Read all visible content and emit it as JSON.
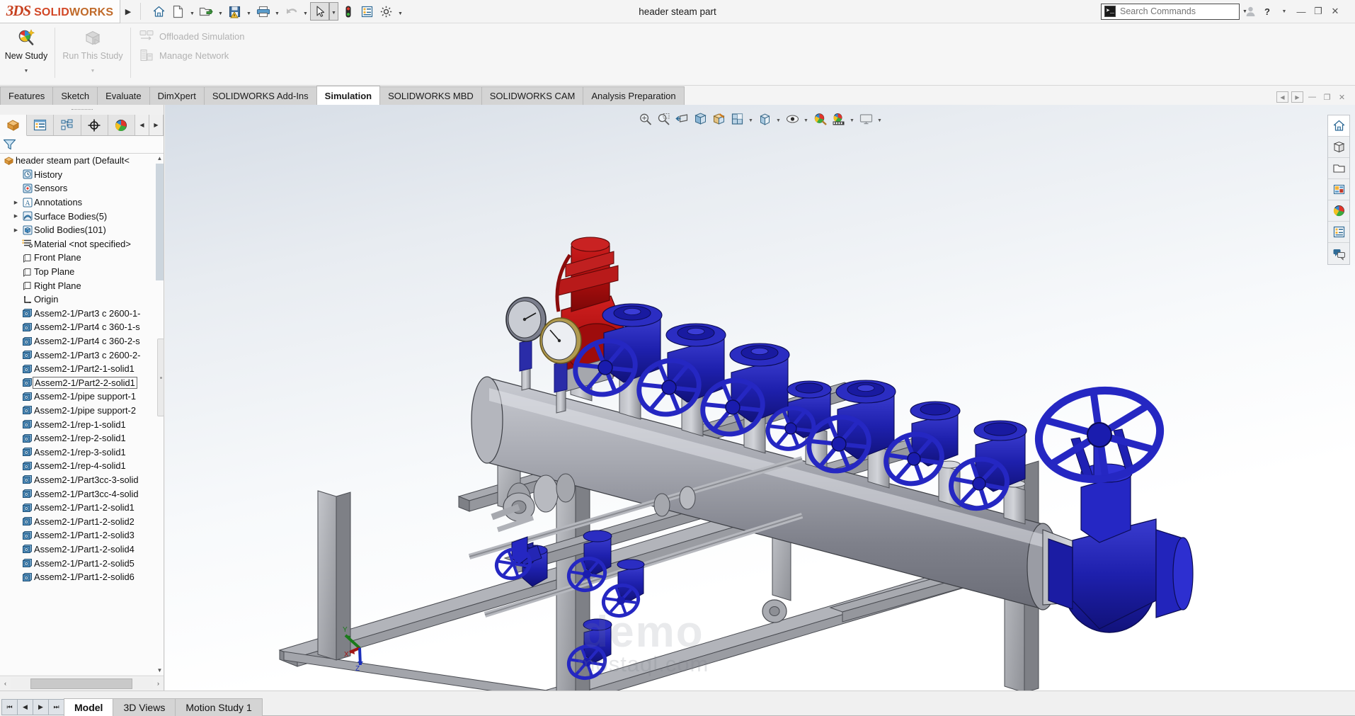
{
  "app": {
    "brand_ds": "3DS",
    "brand_solid": "SOLID",
    "brand_works": "WORKS",
    "document_title": "header steam part"
  },
  "titlebar": {
    "expand_label": "▶",
    "icons": [
      {
        "name": "home-icon",
        "label": "Home"
      },
      {
        "name": "new-document-icon",
        "label": "New"
      },
      {
        "name": "open-folder-icon",
        "label": "Open"
      },
      {
        "name": "save-warning-icon",
        "label": "Save"
      },
      {
        "name": "print-icon",
        "label": "Print"
      },
      {
        "name": "undo-icon",
        "label": "Undo"
      },
      {
        "name": "select-arrow-icon",
        "label": "Select"
      },
      {
        "name": "rebuild-icon",
        "label": "Rebuild"
      },
      {
        "name": "file-properties-icon",
        "label": "File Properties"
      },
      {
        "name": "options-gear-icon",
        "label": "Options"
      }
    ],
    "search": {
      "placeholder": "Search Commands",
      "value": "",
      "prompt_glyph": "➤_",
      "magnifier": "search-icon"
    },
    "account_icon": "user-account-icon",
    "help_label": "?",
    "minimize_label": "—",
    "restore_label": "❐",
    "close_label": "✕"
  },
  "ribbon": {
    "groups": [
      {
        "big_buttons": [
          {
            "name": "new-study-button",
            "label": "New Study",
            "icon": "new-study-icon",
            "disabled": false,
            "dropdown": true
          },
          {
            "name": "run-this-study-button",
            "label": "Run This Study",
            "icon": "run-study-icon",
            "disabled": true,
            "dropdown": true
          }
        ],
        "small_buttons": [
          {
            "name": "offloaded-simulation-button",
            "label": "Offloaded Simulation",
            "icon": "offloaded-simulation-icon",
            "disabled": true
          },
          {
            "name": "manage-network-button",
            "label": "Manage Network",
            "icon": "manage-network-icon",
            "disabled": true
          }
        ]
      }
    ]
  },
  "tabs": {
    "items": [
      {
        "name": "tab-features",
        "label": "Features",
        "active": false
      },
      {
        "name": "tab-sketch",
        "label": "Sketch",
        "active": false
      },
      {
        "name": "tab-evaluate",
        "label": "Evaluate",
        "active": false
      },
      {
        "name": "tab-dimxpert",
        "label": "DimXpert",
        "active": false
      },
      {
        "name": "tab-solidworks-addins",
        "label": "SOLIDWORKS Add-Ins",
        "active": false
      },
      {
        "name": "tab-simulation",
        "label": "Simulation",
        "active": true
      },
      {
        "name": "tab-solidworks-mbd",
        "label": "SOLIDWORKS MBD",
        "active": false
      },
      {
        "name": "tab-solidworks-cam",
        "label": "SOLIDWORKS CAM",
        "active": false
      },
      {
        "name": "tab-analysis-preparation",
        "label": "Analysis Preparation",
        "active": false
      }
    ],
    "right_controls": [
      {
        "name": "pin-left-button",
        "label": "◀"
      },
      {
        "name": "pin-right-button",
        "label": "▶"
      },
      {
        "name": "ribbon-minimize-button",
        "label": "—"
      },
      {
        "name": "ribbon-restore-button",
        "label": "❐"
      },
      {
        "name": "ribbon-close-button",
        "label": "✕"
      }
    ]
  },
  "left_panel": {
    "tabs": [
      {
        "name": "feature-manager-tab",
        "icon": "feature-tree-icon",
        "active": true
      },
      {
        "name": "property-manager-tab",
        "icon": "property-list-icon",
        "active": false
      },
      {
        "name": "configuration-manager-tab",
        "icon": "configuration-icon",
        "active": false
      },
      {
        "name": "dimxpert-manager-tab",
        "icon": "dimxpert-target-icon",
        "active": false
      },
      {
        "name": "display-manager-tab",
        "icon": "display-sphere-icon",
        "active": false
      },
      {
        "name": "tab-scroll-left",
        "icon": "chevron-left-icon",
        "label": "◀",
        "active": false
      },
      {
        "name": "tab-scroll-right",
        "icon": "chevron-right-icon",
        "label": "▶",
        "active": false
      }
    ],
    "filter": {
      "name": "tree-filter-input",
      "placeholder": "",
      "value": "",
      "icon": "funnel-filter-icon"
    },
    "tree": [
      {
        "label": "header steam part  (Default<",
        "icon": "part-icon",
        "indent": 0,
        "expandable": false,
        "selected": false
      },
      {
        "label": "History",
        "icon": "history-icon",
        "indent": 1,
        "expandable": false,
        "selected": false
      },
      {
        "label": "Sensors",
        "icon": "sensors-icon",
        "indent": 1,
        "expandable": false,
        "selected": false
      },
      {
        "label": "Annotations",
        "icon": "annotations-icon",
        "indent": 1,
        "expandable": true,
        "selected": false
      },
      {
        "label": "Surface Bodies(5)",
        "icon": "surface-bodies-icon",
        "indent": 1,
        "expandable": true,
        "selected": false
      },
      {
        "label": "Solid Bodies(101)",
        "icon": "solid-bodies-icon",
        "indent": 1,
        "expandable": true,
        "selected": false
      },
      {
        "label": "Material <not specified>",
        "icon": "material-icon",
        "indent": 1,
        "expandable": false,
        "selected": false
      },
      {
        "label": "Front Plane",
        "icon": "plane-icon",
        "indent": 1,
        "expandable": false,
        "selected": false
      },
      {
        "label": "Top Plane",
        "icon": "plane-icon",
        "indent": 1,
        "expandable": false,
        "selected": false
      },
      {
        "label": "Right Plane",
        "icon": "plane-icon",
        "indent": 1,
        "expandable": false,
        "selected": false
      },
      {
        "label": "Origin",
        "icon": "origin-icon",
        "indent": 1,
        "expandable": false,
        "selected": false
      },
      {
        "label": "Assem2-1/Part3 c 2600-1-",
        "icon": "body-icon",
        "indent": 1,
        "expandable": false,
        "selected": false
      },
      {
        "label": "Assem2-1/Part4 c 360-1-s",
        "icon": "body-icon",
        "indent": 1,
        "expandable": false,
        "selected": false
      },
      {
        "label": "Assem2-1/Part4 c 360-2-s",
        "icon": "body-icon",
        "indent": 1,
        "expandable": false,
        "selected": false
      },
      {
        "label": "Assem2-1/Part3 c 2600-2-",
        "icon": "body-icon",
        "indent": 1,
        "expandable": false,
        "selected": false
      },
      {
        "label": "Assem2-1/Part2-1-solid1",
        "icon": "body-icon",
        "indent": 1,
        "expandable": false,
        "selected": false
      },
      {
        "label": "Assem2-1/Part2-2-solid1",
        "icon": "body-icon",
        "indent": 1,
        "expandable": false,
        "selected": true
      },
      {
        "label": "Assem2-1/pipe support-1",
        "icon": "body-icon",
        "indent": 1,
        "expandable": false,
        "selected": false
      },
      {
        "label": "Assem2-1/pipe support-2",
        "icon": "body-icon",
        "indent": 1,
        "expandable": false,
        "selected": false
      },
      {
        "label": "Assem2-1/rep-1-solid1",
        "icon": "body-icon",
        "indent": 1,
        "expandable": false,
        "selected": false
      },
      {
        "label": "Assem2-1/rep-2-solid1",
        "icon": "body-icon",
        "indent": 1,
        "expandable": false,
        "selected": false
      },
      {
        "label": "Assem2-1/rep-3-solid1",
        "icon": "body-icon",
        "indent": 1,
        "expandable": false,
        "selected": false
      },
      {
        "label": "Assem2-1/rep-4-solid1",
        "icon": "body-icon",
        "indent": 1,
        "expandable": false,
        "selected": false
      },
      {
        "label": "Assem2-1/Part3cc-3-solid",
        "icon": "body-icon",
        "indent": 1,
        "expandable": false,
        "selected": false
      },
      {
        "label": "Assem2-1/Part3cc-4-solid",
        "icon": "body-icon",
        "indent": 1,
        "expandable": false,
        "selected": false
      },
      {
        "label": "Assem2-1/Part1-2-solid1",
        "icon": "body-icon",
        "indent": 1,
        "expandable": false,
        "selected": false
      },
      {
        "label": "Assem2-1/Part1-2-solid2",
        "icon": "body-icon",
        "indent": 1,
        "expandable": false,
        "selected": false
      },
      {
        "label": "Assem2-1/Part1-2-solid3",
        "icon": "body-icon",
        "indent": 1,
        "expandable": false,
        "selected": false
      },
      {
        "label": "Assem2-1/Part1-2-solid4",
        "icon": "body-icon",
        "indent": 1,
        "expandable": false,
        "selected": false
      },
      {
        "label": "Assem2-1/Part1-2-solid5",
        "icon": "body-icon",
        "indent": 1,
        "expandable": false,
        "selected": false
      },
      {
        "label": "Assem2-1/Part1-2-solid6",
        "icon": "body-icon",
        "indent": 1,
        "expandable": false,
        "selected": false
      }
    ]
  },
  "graphics": {
    "hud_tools": [
      {
        "name": "zoom-to-fit-icon",
        "caret": false
      },
      {
        "name": "zoom-to-area-icon",
        "caret": false
      },
      {
        "name": "previous-view-icon",
        "caret": false
      },
      {
        "name": "section-view-icon",
        "caret": false
      },
      {
        "name": "view-orientation-icon",
        "caret": false
      },
      {
        "name": "display-style-icon",
        "caret": true
      },
      {
        "name": "hide-show-items-icon",
        "caret": true
      },
      {
        "name": "edit-appearance-icon",
        "caret": true
      },
      {
        "name": "apply-scene-icon",
        "caret": false
      },
      {
        "name": "view-settings-icon",
        "caret": true
      },
      {
        "name": "viewport-icon",
        "caret": true
      }
    ],
    "right_toolbar": [
      {
        "name": "task-pane-home-icon",
        "active": true
      },
      {
        "name": "design-library-icon",
        "active": false
      },
      {
        "name": "file-explorer-icon",
        "active": false
      },
      {
        "name": "view-palette-icon",
        "active": false
      },
      {
        "name": "appearances-scenes-icon",
        "active": false
      },
      {
        "name": "custom-properties-icon",
        "active": false
      },
      {
        "name": "solidworks-forum-icon",
        "active": false
      }
    ],
    "watermark": {
      "line1": "demo",
      "line2": "mostaql.com"
    },
    "triad": {
      "x_label": "X",
      "y_label": "Y",
      "z_label": "Z",
      "x_color": "#a01414",
      "y_color": "#1a7a1a",
      "z_color": "#1b2fbb"
    },
    "model": {
      "description": "Isometric 3D view of a steam header vessel on a steel frame with branch gate valves",
      "colors": {
        "valve_blue": "#1d1fae",
        "relief_valve_red": "#b41010",
        "steel_grey": "#98999f",
        "vessel_grey": "#8e9099",
        "frame_grey": "#a5a7ad"
      },
      "parts": [
        {
          "name": "steam-header-vessel",
          "color": "#8e9099"
        },
        {
          "name": "pressure-relief-valve",
          "color": "#b41010"
        },
        {
          "name": "pressure-gauge-1",
          "color": "#6d7080"
        },
        {
          "name": "pressure-gauge-2",
          "color": "#b09a4f"
        },
        {
          "name": "branch-gate-valve",
          "color": "#1d1fae",
          "count": 8
        },
        {
          "name": "main-outlet-gate-valve",
          "color": "#1d1fae"
        },
        {
          "name": "steel-support-frame",
          "color": "#a5a7ad"
        }
      ]
    }
  },
  "bottom_bar": {
    "nav_buttons": [
      {
        "name": "first-tab-button",
        "label": "⏮"
      },
      {
        "name": "prev-tab-button",
        "label": "◀"
      },
      {
        "name": "next-tab-button",
        "label": "▶"
      },
      {
        "name": "last-tab-button",
        "label": "⏭"
      }
    ],
    "tabs": [
      {
        "name": "bottom-tab-model",
        "label": "Model",
        "active": true
      },
      {
        "name": "bottom-tab-3d-views",
        "label": "3D Views",
        "active": false
      },
      {
        "name": "bottom-tab-motion-study-1",
        "label": "Motion Study 1",
        "active": false
      }
    ]
  }
}
